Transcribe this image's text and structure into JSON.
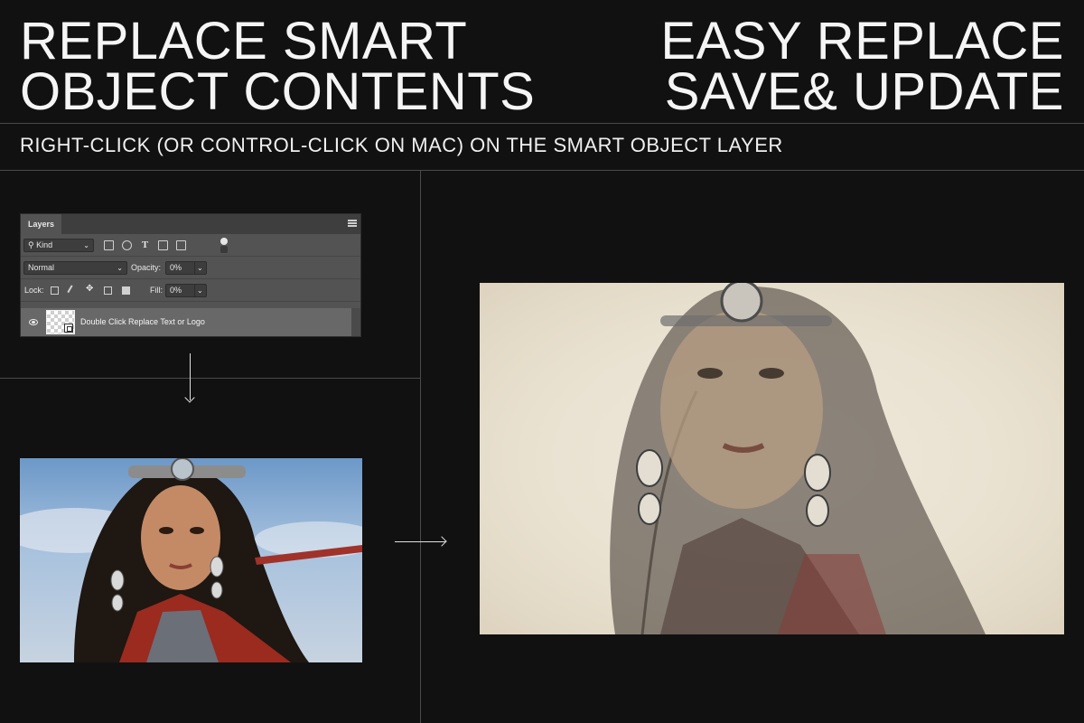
{
  "headline_left": {
    "line1": "REPLACE SMART",
    "line2": "OBJECT CONTENTS"
  },
  "headline_right": {
    "line1": "EASY REPLACE",
    "line2": "SAVE& UPDATE"
  },
  "instruction": "RIGHT-CLICK (OR CONTROL-CLICK ON MAC) ON THE SMART OBJECT LAYER",
  "layers_panel": {
    "tab_label": "Layers",
    "filter": {
      "value": "Kind"
    },
    "blend_mode": "Normal",
    "opacity": {
      "label": "Opacity:",
      "value": "0%"
    },
    "lock": {
      "label": "Lock:"
    },
    "fill": {
      "label": "Fill:",
      "value": "0%"
    },
    "layer": {
      "name": "Double Click Replace Text or Logo",
      "visible": true
    }
  },
  "images": {
    "source": "photo-portrait-woman-headdress",
    "result": "sketch-portrait-on-paper"
  },
  "colors": {
    "background": "#111111",
    "divider": "#4a4a4a",
    "text": "#f5f5f5",
    "panel": "#535353"
  }
}
